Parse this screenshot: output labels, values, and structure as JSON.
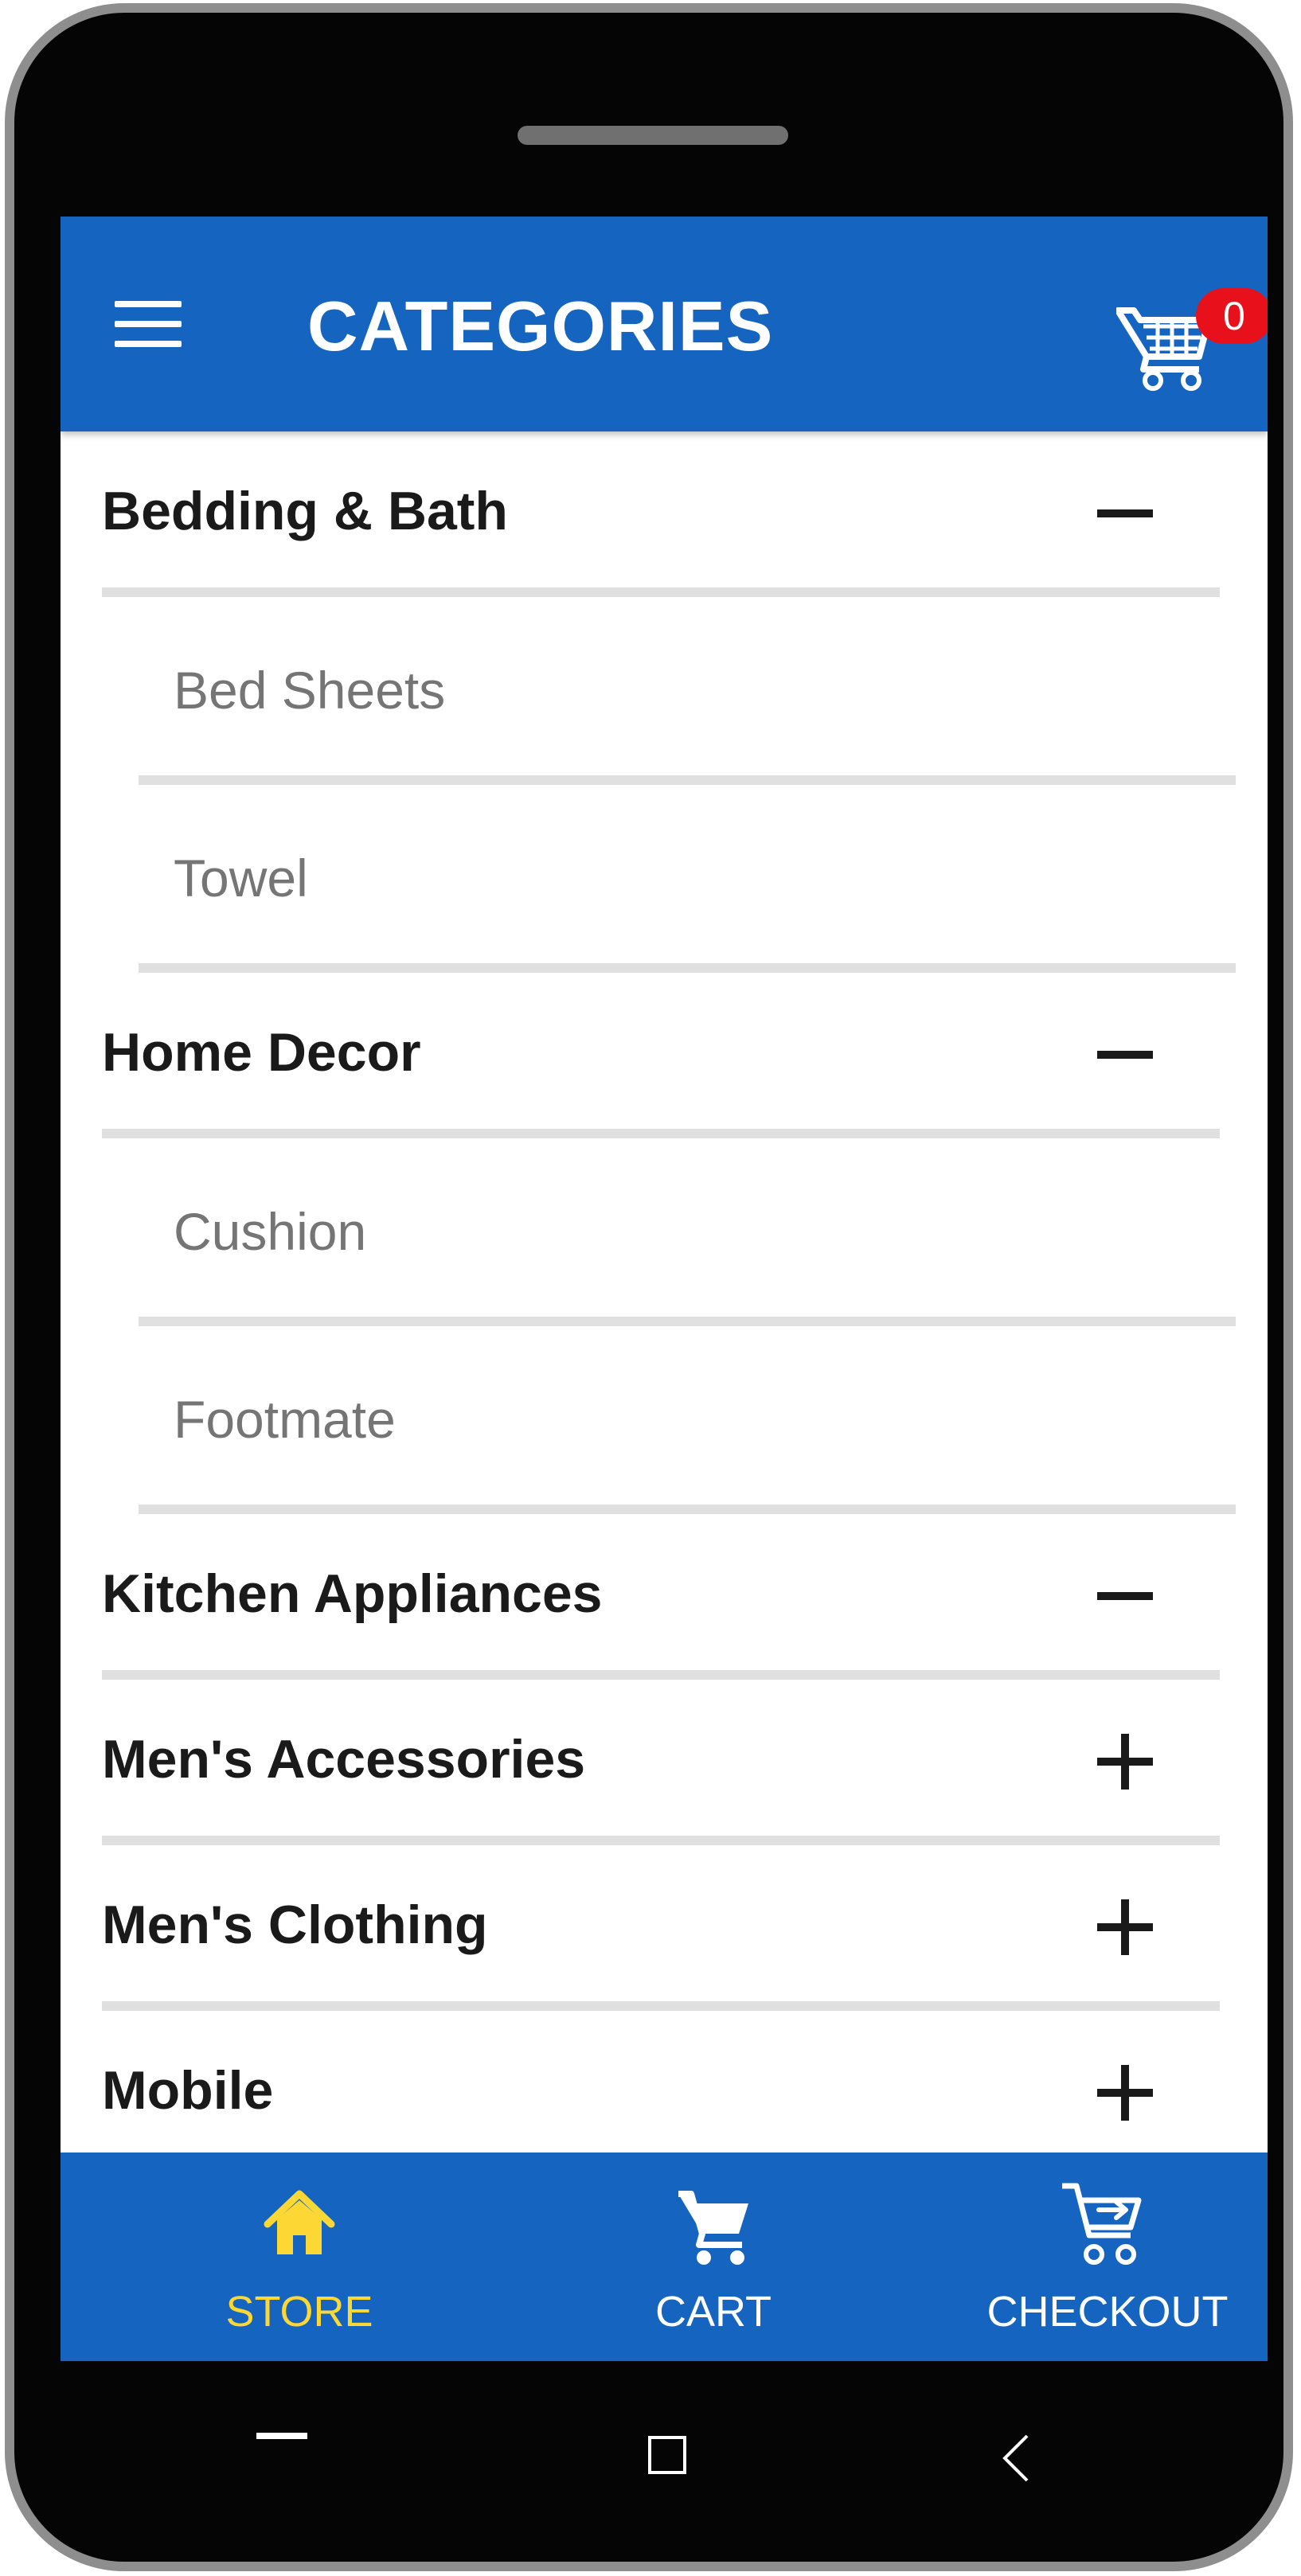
{
  "app_bar": {
    "title": "CATEGORIES",
    "cart_badge": "0",
    "background": "#1565c0"
  },
  "categories": [
    {
      "label": "Bedding & Bath",
      "expanded": true,
      "subcategories": [
        "Bed Sheets",
        "Towel"
      ]
    },
    {
      "label": "Home Decor",
      "expanded": true,
      "subcategories": [
        "Cushion",
        "Footmate"
      ]
    },
    {
      "label": "Kitchen Appliances",
      "expanded": true,
      "subcategories": []
    },
    {
      "label": "Men's Accessories",
      "expanded": false,
      "subcategories": []
    },
    {
      "label": "Men's Clothing",
      "expanded": false,
      "subcategories": []
    },
    {
      "label": "Mobile",
      "expanded": false,
      "subcategories": []
    }
  ],
  "bottom_nav": {
    "items": [
      {
        "label": "STORE",
        "icon": "home-icon",
        "active": true
      },
      {
        "label": "CART",
        "icon": "cart-icon",
        "active": false
      },
      {
        "label": "CHECKOUT",
        "icon": "checkout-cart-icon",
        "active": false
      }
    ],
    "active_color": "#fdd835"
  }
}
